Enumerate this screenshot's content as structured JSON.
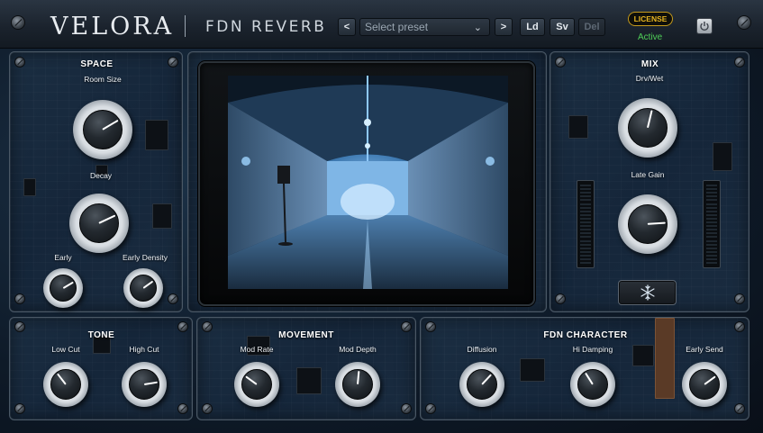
{
  "header": {
    "brand": "VELORA",
    "product": "FDN REVERB",
    "prev_label": "<",
    "next_label": ">",
    "preset_placeholder": "Select preset",
    "load_label": "Ld",
    "save_label": "Sv",
    "delete_label": "Del",
    "license_label": "LICENSE",
    "license_status": "Active"
  },
  "space": {
    "title": "SPACE",
    "room_size": {
      "label": "Room Size",
      "value": 0.72
    },
    "decay": {
      "label": "Decay",
      "value": 0.74
    },
    "early": {
      "label": "Early",
      "value": 0.72
    },
    "early_density": {
      "label": "Early Density",
      "value": 0.7
    }
  },
  "mix": {
    "title": "MIX",
    "dry_wet": {
      "label": "Drv/Wet",
      "value": 0.55
    },
    "late_gain": {
      "label": "Late Gain",
      "value": 0.82
    }
  },
  "tone": {
    "title": "TONE",
    "low_cut": {
      "label": "Low Cut",
      "value": 0.36
    },
    "high_cut": {
      "label": "High Cut",
      "value": 0.8
    }
  },
  "movement": {
    "title": "MOVEMENT",
    "mod_rate": {
      "label": "Mod Rate",
      "value": 0.3
    },
    "mod_depth": {
      "label": "Mod Depth",
      "value": 0.52
    }
  },
  "fdn_character": {
    "title": "FDN CHARACTER",
    "diffusion": {
      "label": "Diffusion",
      "value": 0.66
    },
    "hi_damping": {
      "label": "Hi Damping",
      "value": 0.38
    },
    "early_send": {
      "label": "Early Send",
      "value": 0.7
    }
  },
  "colors": {
    "accent_gold": "#e6b422",
    "status_green": "#4fcf58",
    "screen_blue": "#6fb6ff"
  },
  "icons": {
    "power": "power-icon",
    "freeze": "snowflake-icon",
    "dropdown": "chevron-down-icon"
  }
}
